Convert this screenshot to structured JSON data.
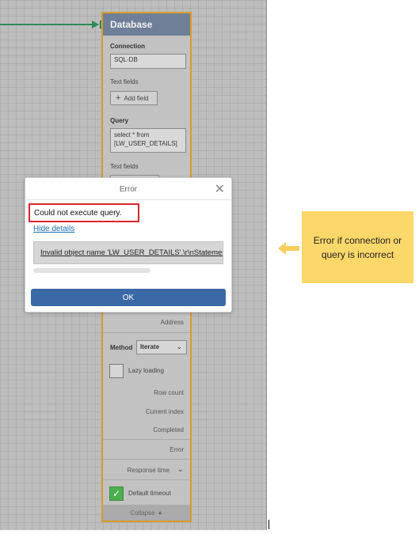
{
  "node": {
    "title": "Database",
    "connection_label": "Connection",
    "connection_value": "SQL-DB",
    "text_fields_label_1": "Text fields",
    "add_field_label": "Add field",
    "query_label": "Query",
    "query_line_1": "select * from",
    "query_line_2": "[LW_USER_DETAILS]",
    "text_fields_label_2": "Text fields",
    "address_label": "Address",
    "method_label": "Method",
    "method_value": "Iterate",
    "lazy_loading_label": "Lazy loading",
    "row_count_label": "Row count",
    "current_index_label": "Current index",
    "completed_label": "Completed",
    "error_label": "Error",
    "response_time_label": "Response time",
    "default_timeout_label": "Default timeout",
    "collapse_label": "Collapse"
  },
  "dialog": {
    "title": "Error",
    "message": "Could not execute query.",
    "hide_details": "Hide details",
    "details_text": "Invalid object name 'LW_USER_DETAILS'.\\r\\nStatement(s) could not be prepared.",
    "ok_label": "OK"
  },
  "callout": {
    "text": "Error if connection or query is incorrect"
  },
  "colors": {
    "node_border": "#d99a2b",
    "node_header": "#6f7f97",
    "ok_button": "#3b69a6",
    "error_box_border": "#d9262f",
    "link": "#1a6fb5",
    "callout_bg": "#fcd86a",
    "connector": "#2e8b57",
    "checkbox_checked": "#4caf50"
  }
}
